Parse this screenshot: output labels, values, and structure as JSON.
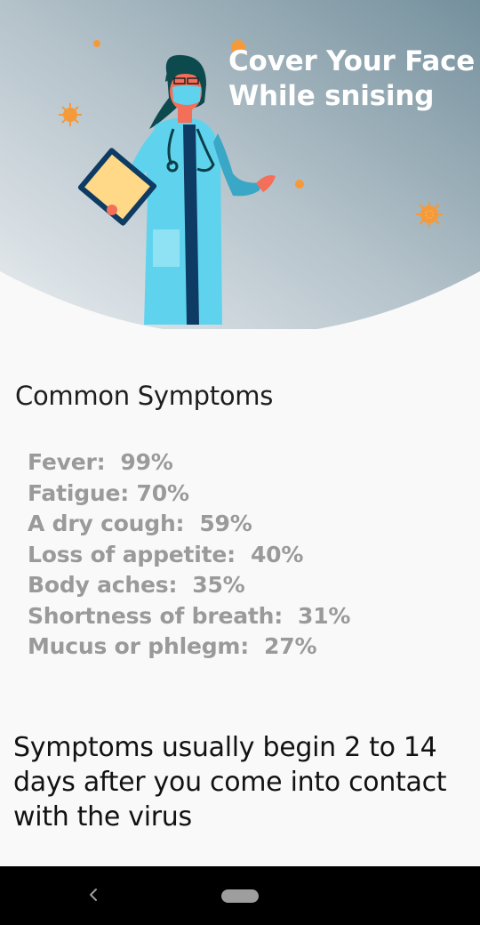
{
  "header": {
    "title_line1": "Cover Your Face",
    "title_line2": "While snising",
    "illustration": "doctor-with-mask-illustration",
    "virus_color": "#f59a3a"
  },
  "symptoms": {
    "title": "Common Symptoms",
    "items": [
      "Fever:  99%",
      "Fatigue: 70%",
      "A dry cough:  59%",
      "Loss of appetite:  40%",
      "Body aches:  35%",
      "Shortness of breath:  31%",
      "Mucus or phlegm:  27%"
    ]
  },
  "onset": {
    "text": "Symptoms usually begin 2 to 14 days after you come into contact with the virus"
  },
  "nav": {
    "back_icon": "back-chevron-icon",
    "home_icon": "home-pill-icon"
  }
}
